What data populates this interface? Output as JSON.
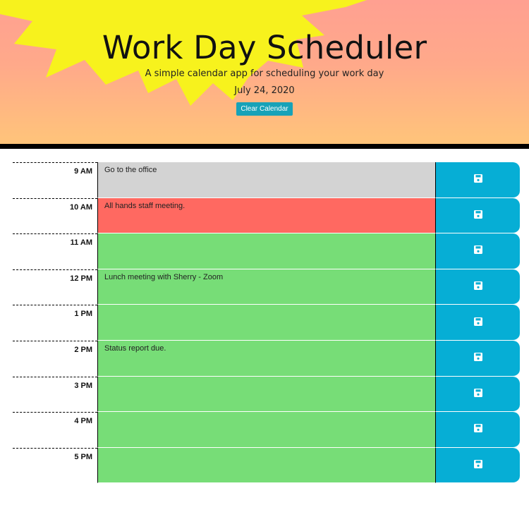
{
  "header": {
    "title": "Work Day Scheduler",
    "subtitle": "A simple calendar app for scheduling your work day",
    "date": "July 24, 2020",
    "clear_label": "Clear Calendar"
  },
  "colors": {
    "past": "#d3d3d3",
    "present": "#ff6961",
    "future": "#77dd77",
    "save_button": "#06aed5",
    "clear_button": "#17a2b8"
  },
  "rows": [
    {
      "hour": "9 AM",
      "text": "Go to the office",
      "state": "past",
      "icon": "save-icon"
    },
    {
      "hour": "10 AM",
      "text": "All hands staff meeting.",
      "state": "present",
      "icon": "save-icon"
    },
    {
      "hour": "11 AM",
      "text": "",
      "state": "future",
      "icon": "save-icon"
    },
    {
      "hour": "12 PM",
      "text": "Lunch meeting with Sherry - Zoom",
      "state": "future",
      "icon": "save-icon"
    },
    {
      "hour": "1 PM",
      "text": "",
      "state": "future",
      "icon": "save-icon"
    },
    {
      "hour": "2 PM",
      "text": "Status report due.",
      "state": "future",
      "icon": "save-icon"
    },
    {
      "hour": "3 PM",
      "text": "",
      "state": "future",
      "icon": "save-icon"
    },
    {
      "hour": "4 PM",
      "text": "",
      "state": "future",
      "icon": "save-icon"
    },
    {
      "hour": "5 PM",
      "text": "",
      "state": "future",
      "icon": "save-icon"
    }
  ]
}
